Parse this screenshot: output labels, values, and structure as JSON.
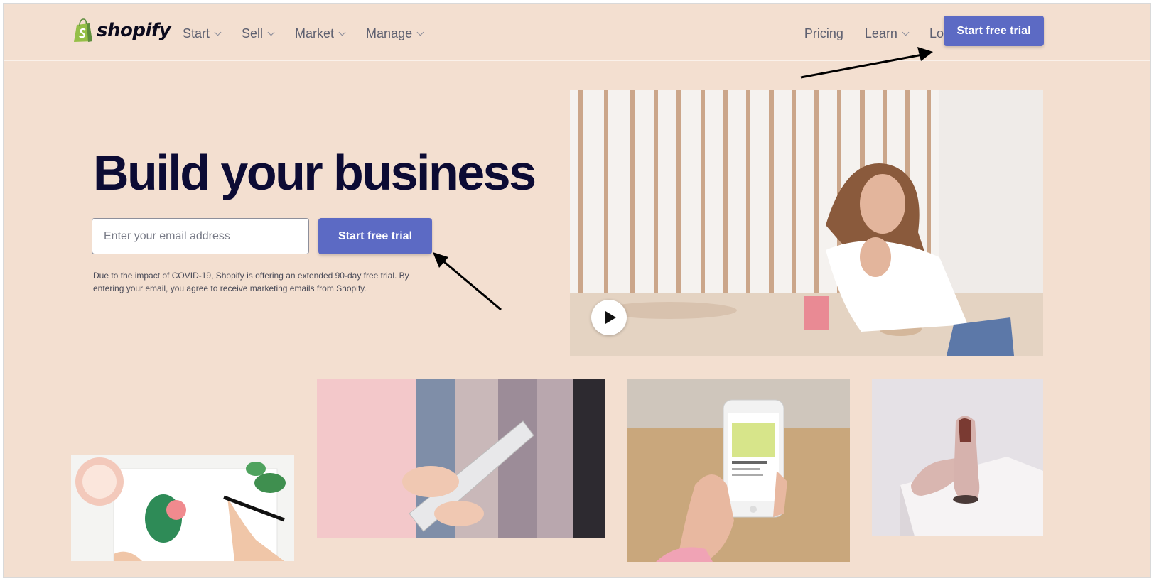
{
  "brand": {
    "name": "shopify",
    "accent_color": "#5c6ac4",
    "logo_color": "#95bf47",
    "background_color": "#f3dfd0",
    "title_color": "#0c0b34"
  },
  "nav": {
    "left": [
      {
        "label": "Start",
        "has_dropdown": true
      },
      {
        "label": "Sell",
        "has_dropdown": true
      },
      {
        "label": "Market",
        "has_dropdown": true
      },
      {
        "label": "Manage",
        "has_dropdown": true
      }
    ],
    "right": [
      {
        "label": "Pricing",
        "has_dropdown": false
      },
      {
        "label": "Learn",
        "has_dropdown": true
      },
      {
        "label": "Log in",
        "has_dropdown": false
      }
    ],
    "cta_label": "Start free trial"
  },
  "hero": {
    "title": "Build your business",
    "email_placeholder": "Enter your email address",
    "cta_label": "Start free trial",
    "disclaimer": "Due to the impact of COVID-19, Shopify is offering an extended 90-day free trial. By entering your email, you agree to receive marketing emails from Shopify."
  },
  "icons": {
    "logo": "shopping-bag-icon",
    "dropdown": "chevron-down-icon",
    "play": "play-icon",
    "annotation": "arrow-annotation-icon"
  }
}
